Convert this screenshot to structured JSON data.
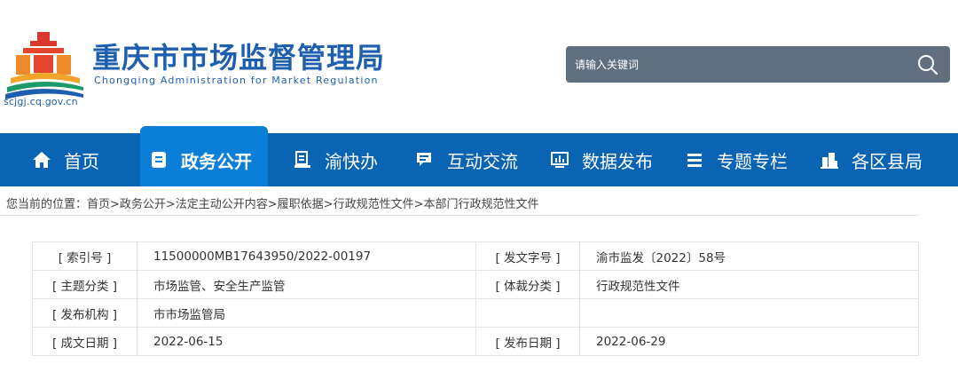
{
  "header": {
    "logo_url_text": "scjgj.cq.gov.cn",
    "title": "重庆市市场监督管理局",
    "subtitle": "Chongqing  Administration for Market Regulation",
    "search_placeholder": "请输入关键词",
    "colors": {
      "brand_blue": "#1d5fae",
      "search_bg": "#5f6f80"
    }
  },
  "nav": {
    "items": [
      {
        "label": "首页",
        "icon": "home-icon"
      },
      {
        "label": "政务公开",
        "icon": "document-icon",
        "active": true
      },
      {
        "label": "渝快办",
        "icon": "service-icon"
      },
      {
        "label": "互动交流",
        "icon": "chat-icon"
      },
      {
        "label": "数据发布",
        "icon": "monitor-chart-icon"
      },
      {
        "label": "专题专栏",
        "icon": "list-icon"
      },
      {
        "label": "各区县局",
        "icon": "buildings-icon"
      }
    ],
    "colors": {
      "bar": "#0a64b4",
      "active": "#0b7fd8"
    }
  },
  "breadcrumb": "您当前的位置：首页>政务公开>法定主动公开内容>履职依据>行政规范性文件>本部门行政规范性文件",
  "info_table": {
    "rows": [
      {
        "k1": "[ 索引号 ]",
        "v1": "11500000MB17643950/2022-00197",
        "k2": "[ 发文字号 ]",
        "v2": "渝市监发〔2022〕58号"
      },
      {
        "k1": "[ 主题分类 ]",
        "v1": "市场监管、安全生产监管",
        "k2": "[ 体裁分类 ]",
        "v2": "行政规范性文件"
      },
      {
        "k1": "[ 发布机构 ]",
        "v1": "市市场监管局",
        "k2": "",
        "v2": ""
      },
      {
        "k1": "[ 成文日期 ]",
        "v1": "2022-06-15",
        "k2": "[ 发布日期 ]",
        "v2": "2022-06-29"
      }
    ]
  }
}
